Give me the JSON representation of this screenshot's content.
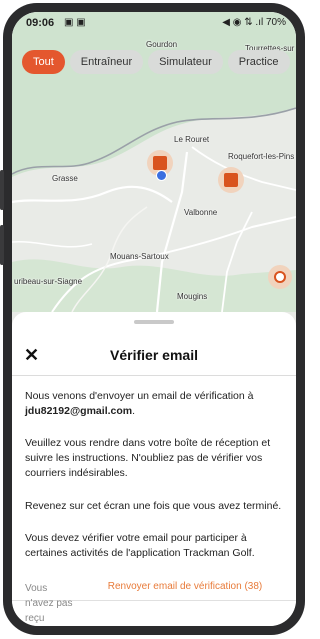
{
  "status_bar": {
    "time": "09:06",
    "left_icons": "▣ ▣",
    "right_text": "◀ ◉ ⇅ .ıl 70%"
  },
  "filters": {
    "chips": [
      "Tout",
      "Entraîneur",
      "Simulateur",
      "Practice"
    ],
    "selected": "Tout"
  },
  "map": {
    "labels": [
      "Gourdon",
      "Tourrettes-sur",
      "Le Rouret",
      "Roquefort-les-Pins",
      "Grasse",
      "Valbonne",
      "Mouans-Sartoux",
      "uribeau-sur-Siagne",
      "Mougins"
    ]
  },
  "sheet": {
    "title": "Vérifier email",
    "paragraph1_prefix": "Nous venons d'envoyer un email de vérification à",
    "email": "jdu82192@gmail.com",
    "paragraph1_suffix": ".",
    "paragraph2": "Veuillez vous rendre dans votre boîte de réception et suivre les instructions. N'oubliez pas de vérifier vos courriers indésirables.",
    "paragraph3": "Revenez sur cet écran une fois que vous avez terminé.",
    "paragraph4": "Vous devez vérifier votre email pour participer à certaines activités de l'application Trackman Golf.",
    "footer_left": "Vous n'avez pas reçu",
    "resend_label": "Renvoyer email de vérification (38)"
  },
  "colors": {
    "accent": "#e4572e",
    "link": "#e87b3a"
  }
}
